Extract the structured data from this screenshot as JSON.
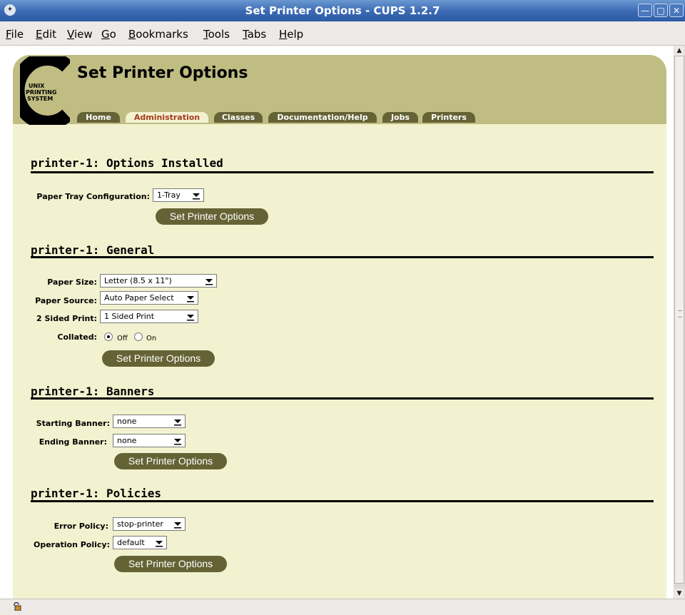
{
  "window": {
    "title": "Set Printer Options - CUPS 1.2.7",
    "app_icon": "firefox-icon",
    "controls": [
      "minimize-icon",
      "maximize-icon",
      "close-icon"
    ]
  },
  "menu": {
    "items": [
      {
        "key": "F",
        "rest": "ile"
      },
      {
        "key": "E",
        "rest": "dit"
      },
      {
        "key": "V",
        "rest": "iew"
      },
      {
        "key": "G",
        "rest": "o"
      },
      {
        "key": "B",
        "rest": "ookmarks"
      },
      {
        "key": "T",
        "rest": "ools",
        "pre": ""
      },
      {
        "key": "T",
        "rest": "abs"
      },
      {
        "key": "H",
        "rest": "elp"
      }
    ]
  },
  "logo": {
    "line1": "UNIX",
    "line2": "PRINTING",
    "line3": "SYSTEM"
  },
  "page": {
    "heading": "Set Printer Options",
    "tabs": [
      "Home",
      "Administration",
      "Classes",
      "Documentation/Help",
      "Jobs",
      "Printers"
    ],
    "active_tab": "Administration"
  },
  "sections": {
    "installed": {
      "heading": "printer-1: Options Installed",
      "paper_tray_label": "Paper Tray Configuration:",
      "paper_tray_value": "1-Tray",
      "button": "Set Printer Options"
    },
    "general": {
      "heading": "printer-1: General",
      "paper_size_label": "Paper Size:",
      "paper_size_value": "Letter (8.5 x 11\")",
      "paper_source_label": "Paper Source:",
      "paper_source_value": "Auto Paper Select",
      "two_sided_label": "2 Sided Print:",
      "two_sided_value": "1 Sided Print",
      "collated_label": "Collated:",
      "collated_off": "Off",
      "collated_on": "On",
      "collated_selected": "Off",
      "button": "Set Printer Options"
    },
    "banners": {
      "heading": "printer-1: Banners",
      "starting_label": "Starting Banner:",
      "starting_value": "none",
      "ending_label": "Ending Banner:",
      "ending_value": "none",
      "button": "Set Printer Options"
    },
    "policies": {
      "heading": "printer-1: Policies",
      "error_label": "Error Policy:",
      "error_value": "stop-printer",
      "operation_label": "Operation Policy:",
      "operation_value": "default",
      "button": "Set Printer Options"
    }
  },
  "colors": {
    "header_olive": "#bfbd82",
    "content_cream": "#f2f2d0",
    "tab_dark": "#656335",
    "active_tab_text": "#a53a1e",
    "titlebar_blue": "#3a69b4"
  },
  "statusbar": {
    "icon": "security-lock-icon"
  }
}
